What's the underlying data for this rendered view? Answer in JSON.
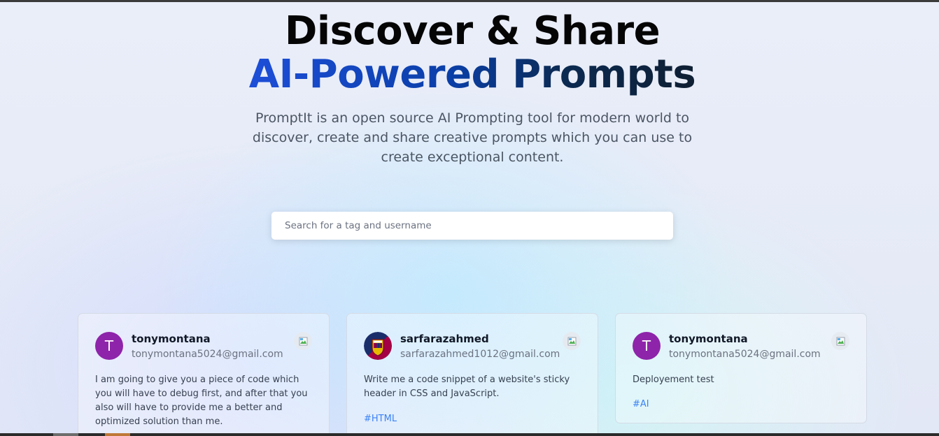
{
  "hero": {
    "title_line1": "Discover & Share",
    "title_line2": "AI-Powered Prompts",
    "description": "PromptIt is an open source AI Prompting tool for modern world to discover, create and share creative prompts which you can use to create exceptional content."
  },
  "search": {
    "placeholder": "Search for a tag and username",
    "value": ""
  },
  "prompts": [
    {
      "username": "tonymontana",
      "email": "tonymontana5024@gmail.com",
      "avatar_letter": "T",
      "avatar_color": "#8e24aa",
      "prompt": "I am going to give you a piece of code which you will have to debug first, and after that you also will have to provide me a better and optimized solution than me.",
      "tag": ""
    },
    {
      "username": "sarfarazahmed",
      "email": "sarfarazahmed1012@gmail.com",
      "avatar_icon": "club-crest-avatar",
      "prompt": "Write me a code snippet of a website's sticky header in CSS and JavaScript.",
      "tag": "#HTML"
    },
    {
      "username": "tonymontana",
      "email": "tonymontana5024@gmail.com",
      "avatar_letter": "T",
      "avatar_color": "#8e24aa",
      "prompt": "Deployement test",
      "tag": "#AI"
    }
  ],
  "icons": {
    "copy": "copy-image-icon"
  },
  "colors": {
    "accent_blue": "#1d4ed8",
    "tag_blue": "#3b82f6",
    "avatar_purple": "#8e24aa"
  }
}
